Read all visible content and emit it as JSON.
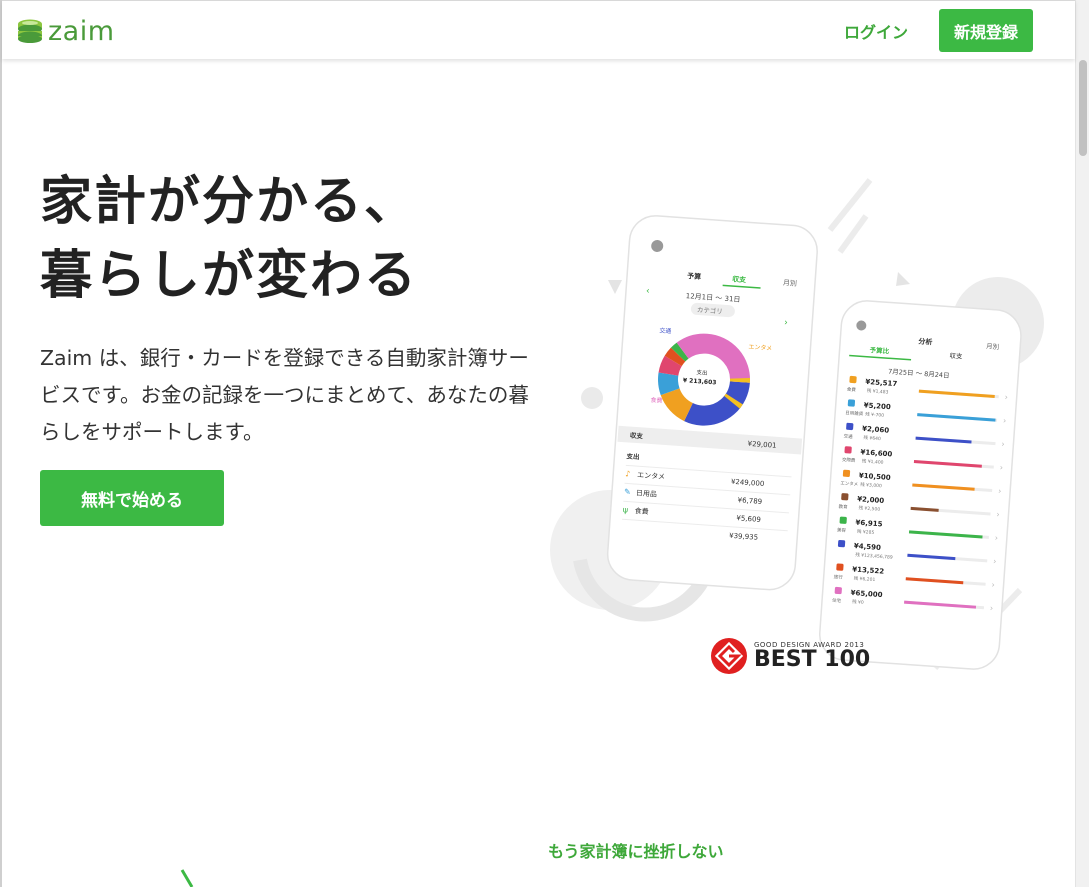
{
  "header": {
    "logo_text": "zaim",
    "login_label": "ログイン",
    "signup_label": "新規登録"
  },
  "hero": {
    "title_line1": "家計が分かる、",
    "title_line2": "暮らしが変わる",
    "description": "Zaim は、銀行・カードを登録できる自動家計簿サービスです。お金の記録を一つにまとめて、あなたの暮らしをサポートします。",
    "cta_label": "無料で始める"
  },
  "phone_left": {
    "tabs": [
      "予算",
      "収支",
      "月別"
    ],
    "date_range": "12月1日 〜 31日",
    "category_pill": "カテゴリ",
    "donut_center_label": "支出",
    "donut_center_value": "¥ 213,603",
    "donut_labels": [
      "交通",
      "エンタメ",
      "食費"
    ],
    "income_label": "収支",
    "income_value": "¥29,001",
    "expense_label": "支出",
    "rows": [
      {
        "name": "エンタメ",
        "value": "¥249,000"
      },
      {
        "name": "日用品",
        "value": "¥6,789"
      },
      {
        "name": "食費",
        "value": "¥5,609"
      },
      {
        "name": "",
        "value": "¥39,935"
      }
    ]
  },
  "phone_right": {
    "title": "分析",
    "corner": "月別",
    "tabs": [
      "予算比",
      "収支"
    ],
    "date_range": "7月25日 〜 8月24日",
    "rows": [
      {
        "cat": "食費",
        "value": "¥25,517",
        "sub": "残 ¥1,483",
        "color": "#f0a020",
        "fill": 0.95
      },
      {
        "cat": "日用雑貨",
        "value": "¥5,200",
        "sub": "残 ¥-700",
        "color": "#3aa0d8",
        "fill": 0.98
      },
      {
        "cat": "交通",
        "value": "¥2,060",
        "sub": "残 ¥640",
        "color": "#3d50c8",
        "fill": 0.7
      },
      {
        "cat": "交際費",
        "value": "¥16,600",
        "sub": "残 ¥1,400",
        "color": "#e0466e",
        "fill": 0.85
      },
      {
        "cat": "エンタメ",
        "value": "¥10,500",
        "sub": "残 ¥3,000",
        "color": "#f09020",
        "fill": 0.78
      },
      {
        "cat": "教育",
        "value": "¥2,000",
        "sub": "残 ¥2,500",
        "color": "#8a5030",
        "fill": 0.35
      },
      {
        "cat": "美容",
        "value": "¥6,915",
        "sub": "残 ¥285",
        "color": "#3cb44a",
        "fill": 0.92
      },
      {
        "cat": "",
        "value": "¥4,590",
        "sub": "残 ¥123,456,789",
        "color": "#3d50c8",
        "fill": 0.6
      },
      {
        "cat": "旅行",
        "value": "¥13,522",
        "sub": "残 ¥6,201",
        "color": "#e05020",
        "fill": 0.72
      },
      {
        "cat": "住宅",
        "value": "¥65,000",
        "sub": "残 ¥0",
        "color": "#e070c0",
        "fill": 0.9
      }
    ]
  },
  "award": {
    "small_text": "GOOD DESIGN AWARD 2013",
    "big_text": "BEST 100"
  },
  "tagline": "もう家計簿に挫折しない",
  "colors": {
    "brand_green": "#3cb944",
    "link_green": "#3ea83a"
  }
}
